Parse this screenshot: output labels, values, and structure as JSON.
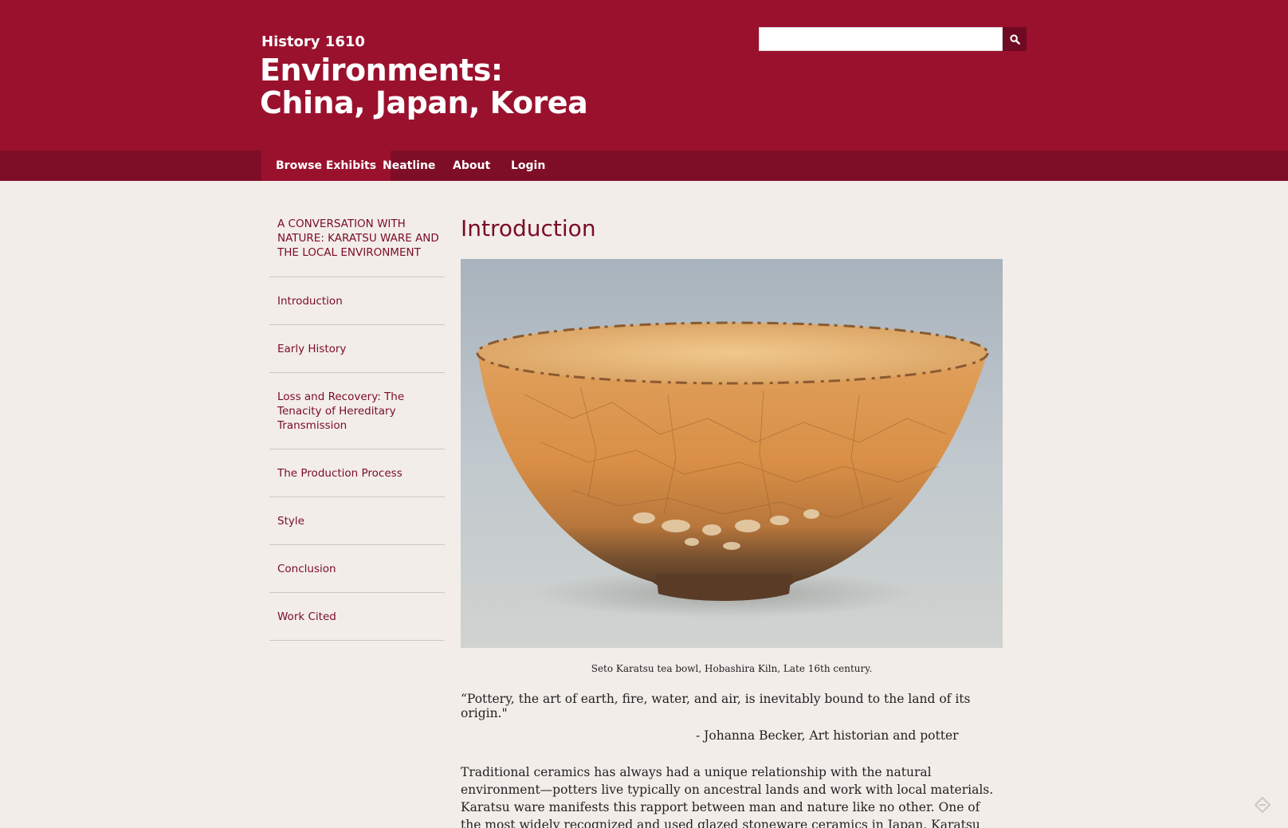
{
  "header": {
    "course": "History 1610",
    "title": "Environments: China, Japan, Korea",
    "search": {
      "value": "",
      "placeholder": "",
      "icon": "search-icon"
    }
  },
  "nav": {
    "items": [
      {
        "label": "Browse Exhibits",
        "active": true
      },
      {
        "label": "Neatline",
        "active": false
      },
      {
        "label": "About",
        "active": false
      },
      {
        "label": "Login",
        "active": false
      }
    ]
  },
  "sidebar": {
    "title": "A CONVERSATION WITH NATURE: KARATSU WARE AND THE LOCAL ENVIRONMENT",
    "items": [
      {
        "label": "Introduction"
      },
      {
        "label": "Early History"
      },
      {
        "label": "Loss and Recovery: The Tenacity of Hereditary Transmission"
      },
      {
        "label": "The Production Process"
      },
      {
        "label": "Style"
      },
      {
        "label": "Conclusion"
      },
      {
        "label": "Work Cited"
      }
    ]
  },
  "main": {
    "heading": "Introduction",
    "caption": "Seto Karatsu tea bowl, Hobashira Kiln, Late 16th century.",
    "quote": "“Pottery, the art of earth, fire, water, and air, is inevitably bound to the land of its origin.\"",
    "attribution": "- Johanna Becker, Art historian and potter",
    "body": "Traditional ceramics has always had a unique relationship with the natural environment—potters live typically on ancestral lands and work with local materials. Karatsu ware manifests this rapport between man and nature like no other. One of the most widely recognized and used glazed stoneware ceramics in Japan, Karatsu ware is known for its subtle complexity and"
  },
  "colors": {
    "header_bg": "#9a112e",
    "nav_bg": "#7e0e27",
    "accent_text": "#7a0c26",
    "page_bg": "#f3ede9"
  }
}
